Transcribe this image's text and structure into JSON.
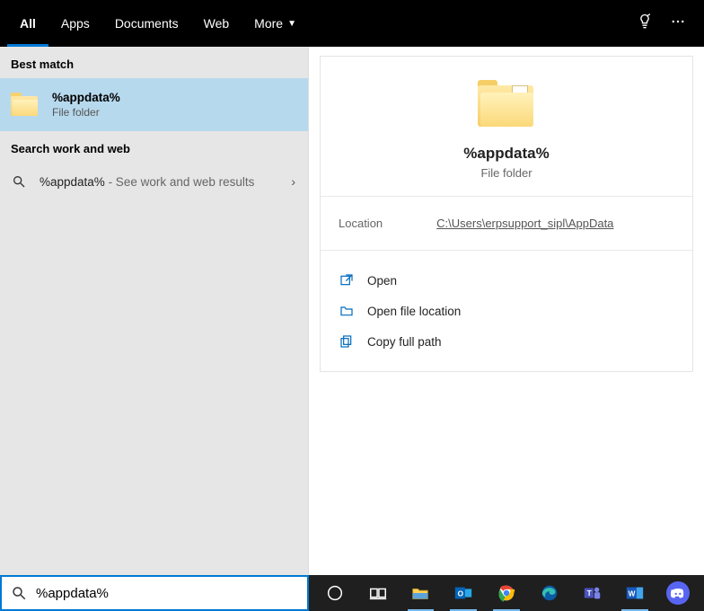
{
  "tabs": {
    "all": "All",
    "apps": "Apps",
    "documents": "Documents",
    "web": "Web",
    "more": "More"
  },
  "left": {
    "best_match_label": "Best match",
    "best_result": {
      "title": "%appdata%",
      "subtitle": "File folder"
    },
    "work_web_label": "Search work and web",
    "web_result": {
      "query": "%appdata%",
      "desc": " - See work and web results"
    }
  },
  "preview": {
    "title": "%appdata%",
    "subtitle": "File folder",
    "location_label": "Location",
    "location_value": "C:\\Users\\erpsupport_sipl\\AppData"
  },
  "actions": {
    "open": "Open",
    "open_loc": "Open file location",
    "copy_path": "Copy full path"
  },
  "search": {
    "value": "%appdata%"
  }
}
